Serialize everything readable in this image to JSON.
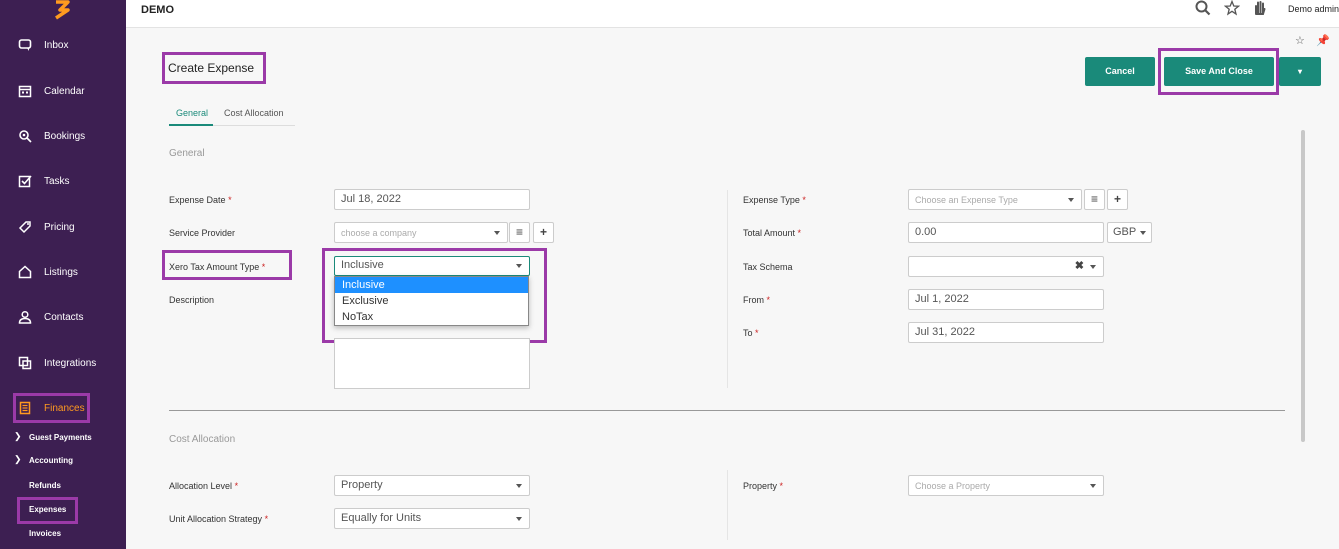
{
  "app": {
    "brand": "DEMO",
    "user": "Demo admin"
  },
  "colors": {
    "sidebar": "#3d1f52",
    "accent": "#1a8a7a",
    "active_nav": "#ff9a1f",
    "highlight": "#9b3aa8",
    "selected_option": "#1e90ff"
  },
  "icons": {
    "logo": "brand-logo",
    "search": "search-icon",
    "star": "star-icon",
    "hand": "hand-icon",
    "pin": "pin-icon"
  },
  "sidebar": {
    "items": [
      {
        "label": "Inbox",
        "icon": "chat-icon"
      },
      {
        "label": "Calendar",
        "icon": "calendar-icon"
      },
      {
        "label": "Bookings",
        "icon": "bookings-icon"
      },
      {
        "label": "Tasks",
        "icon": "tasks-icon"
      },
      {
        "label": "Pricing",
        "icon": "tag-icon"
      },
      {
        "label": "Listings",
        "icon": "home-icon"
      },
      {
        "label": "Contacts",
        "icon": "person-icon"
      },
      {
        "label": "Integrations",
        "icon": "integrations-icon"
      },
      {
        "label": "Finances",
        "icon": "finances-icon",
        "active": true
      }
    ],
    "sub_items": [
      "Guest Payments",
      "Accounting",
      "Refunds",
      "Expenses",
      "Invoices"
    ]
  },
  "page": {
    "title": "Create Expense",
    "tabs": [
      "General",
      "Cost Allocation"
    ],
    "buttons": {
      "cancel": "Cancel",
      "save": "Save And Close"
    }
  },
  "general": {
    "section": "General",
    "expense_date": {
      "label": "Expense Date",
      "value": "Jul 18, 2022"
    },
    "service_provider": {
      "label": "Service Provider",
      "placeholder": "choose a company"
    },
    "xero_tax": {
      "label": "Xero Tax Amount Type",
      "value": "Inclusive",
      "options": [
        "Inclusive",
        "Exclusive",
        "NoTax"
      ]
    },
    "description": {
      "label": "Description"
    },
    "expense_type": {
      "label": "Expense Type",
      "placeholder": "Choose an Expense Type"
    },
    "total_amount": {
      "label": "Total Amount",
      "value": "0.00",
      "currency": "GBP"
    },
    "tax_schema": {
      "label": "Tax Schema"
    },
    "from": {
      "label": "From",
      "value": "Jul 1, 2022"
    },
    "to": {
      "label": "To",
      "value": "Jul 31, 2022"
    }
  },
  "cost_allocation": {
    "section": "Cost Allocation",
    "allocation_level": {
      "label": "Allocation Level",
      "value": "Property"
    },
    "unit_strategy": {
      "label": "Unit Allocation Strategy",
      "value": "Equally for Units"
    },
    "property": {
      "label": "Property",
      "placeholder": "Choose a Property"
    }
  }
}
